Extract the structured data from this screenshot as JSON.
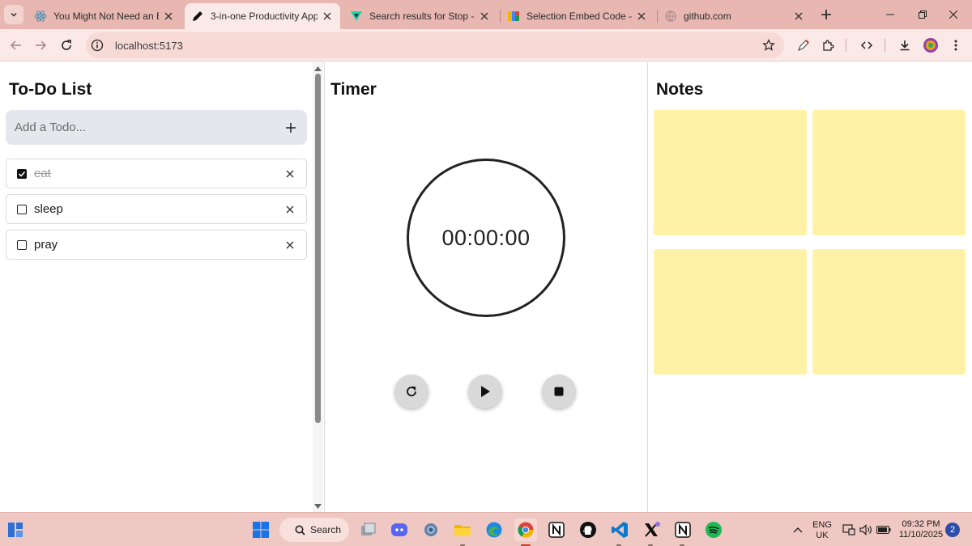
{
  "browser": {
    "tabs": [
      {
        "title": "You Might Not Need an Effe",
        "favicon": "react-icon",
        "active": false
      },
      {
        "title": "3-in-one Productivity App",
        "favicon": "pencil-icon",
        "active": true
      },
      {
        "title": "Search results for Stop - Flat",
        "favicon": "flaticon-icon",
        "active": false
      },
      {
        "title": "Selection Embed Code - Goo",
        "favicon": "google-fonts-icon",
        "active": false
      },
      {
        "title": "github.com",
        "favicon": "globe-icon",
        "active": false
      }
    ],
    "url": "localhost:5173"
  },
  "todo": {
    "title": "To-Do List",
    "input_placeholder": "Add a Todo...",
    "items": [
      {
        "text": "eat",
        "done": true
      },
      {
        "text": "sleep",
        "done": false
      },
      {
        "text": "pray",
        "done": false
      }
    ]
  },
  "timer": {
    "title": "Timer",
    "display": "00:00:00",
    "controls": [
      "reset-icon",
      "play-icon",
      "stop-icon"
    ]
  },
  "notes": {
    "title": "Notes",
    "count": 4,
    "note_color": "#fff1a6"
  },
  "taskbar": {
    "search_label": "Search",
    "language": "ENG",
    "region": "UK",
    "time": "09:32 PM",
    "date": "11/10/2025",
    "notification_count": "2"
  },
  "colors": {
    "tabstrip": "#e8b7b1",
    "toolbar": "#fbe9e7",
    "taskbar": "#f0c8c3",
    "note_yellow": "#fff1a6",
    "input_bg": "#e6e7ec"
  }
}
